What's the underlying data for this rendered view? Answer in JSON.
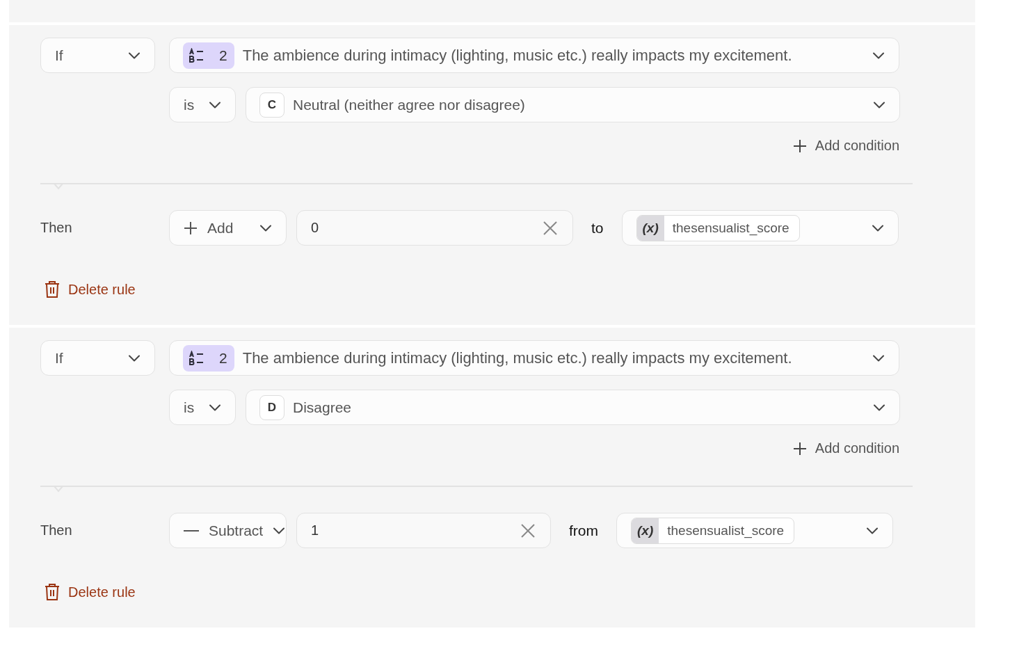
{
  "rules": [
    {
      "if_label": "If",
      "question": {
        "number": "2",
        "text": "The ambience during intimacy (lighting, music etc.) really impacts my excitement."
      },
      "conditions": [
        {
          "operator": "is",
          "answer_letter": "C",
          "answer": "Neutral (neither agree nor disagree)"
        }
      ],
      "add_condition": "Add condition",
      "then_label": "Then",
      "action": {
        "kind": "add",
        "label": "Add",
        "value": "0",
        "preposition": "to",
        "variable_icon": "(x)",
        "variable": "thesensualist_score"
      },
      "delete_label": "Delete rule"
    },
    {
      "if_label": "If",
      "question": {
        "number": "2",
        "text": "The ambience during intimacy (lighting, music etc.) really impacts my excitement."
      },
      "conditions": [
        {
          "operator": "is",
          "answer_letter": "D",
          "answer": "Disagree"
        }
      ],
      "add_condition": "Add condition",
      "then_label": "Then",
      "action": {
        "kind": "subtract",
        "label": "Subtract",
        "value": "1",
        "preposition": "from",
        "variable_icon": "(x)",
        "variable": "thesensualist_score"
      },
      "delete_label": "Delete rule"
    }
  ]
}
